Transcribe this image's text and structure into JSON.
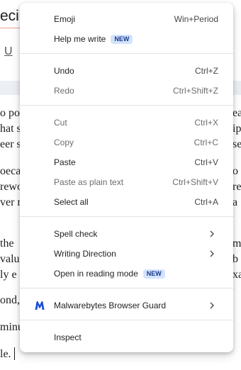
{
  "background": {
    "title_fragment": "ecipe",
    "toolbar_u": "U",
    "left_lines": [
      "o pot",
      "hat s",
      "eer s",
      "oeca",
      "rewo",
      "ver n",
      "the",
      "valu",
      "ly e",
      "ond,",
      "minu",
      "le."
    ],
    "right_lines": [
      "ea",
      "ip",
      "se",
      "o",
      "re",
      "a",
      "m",
      "b",
      "xa"
    ]
  },
  "menu": {
    "items": [
      {
        "id": "emoji",
        "label": "Emoji",
        "shortcut": "Win+Period"
      },
      {
        "id": "help-me-write",
        "label": "Help me write",
        "badge": "NEW"
      },
      {
        "id": "undo",
        "label": "Undo",
        "shortcut": "Ctrl+Z"
      },
      {
        "id": "redo",
        "label": "Redo",
        "shortcut": "Ctrl+Shift+Z",
        "disabled": true
      },
      {
        "id": "cut",
        "label": "Cut",
        "shortcut": "Ctrl+X",
        "disabled": true
      },
      {
        "id": "copy",
        "label": "Copy",
        "shortcut": "Ctrl+C",
        "disabled": true
      },
      {
        "id": "paste",
        "label": "Paste",
        "shortcut": "Ctrl+V"
      },
      {
        "id": "paste-plain",
        "label": "Paste as plain text",
        "shortcut": "Ctrl+Shift+V",
        "disabled": true
      },
      {
        "id": "select-all",
        "label": "Select all",
        "shortcut": "Ctrl+A"
      },
      {
        "id": "spell-check",
        "label": "Spell check",
        "submenu": true
      },
      {
        "id": "writing-direction",
        "label": "Writing Direction",
        "submenu": true
      },
      {
        "id": "reading-mode",
        "label": "Open in reading mode",
        "badge": "NEW"
      },
      {
        "id": "malwarebytes",
        "label": "Malwarebytes Browser Guard",
        "submenu": true,
        "icon": "malwarebytes-icon"
      },
      {
        "id": "inspect",
        "label": "Inspect"
      }
    ]
  },
  "colors": {
    "badge_bg": "#d3e3fd",
    "badge_text": "#1a3a8a",
    "malwarebytes": "#1c4fd8",
    "separator": "#dfe3e9"
  }
}
